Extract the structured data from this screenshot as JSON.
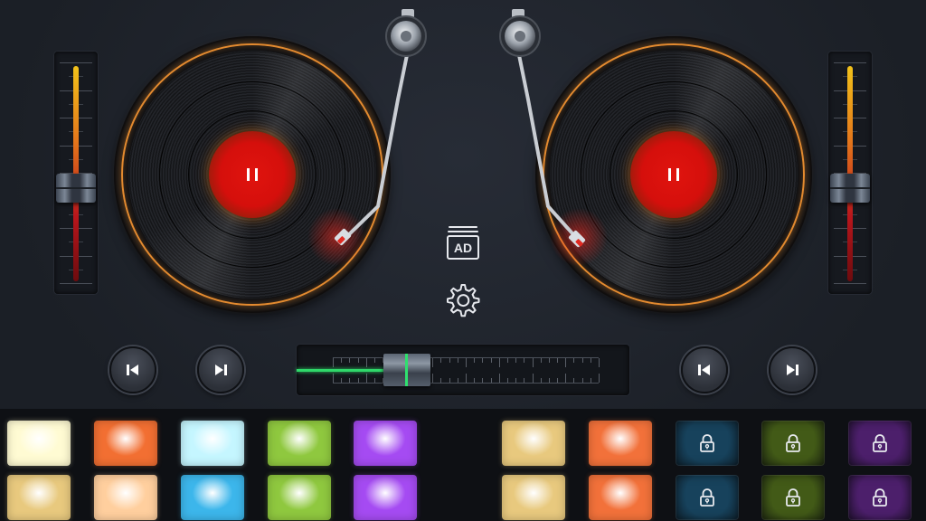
{
  "center": {
    "ad_label": "AD"
  },
  "icons": {
    "pause": "pause-icon",
    "skip_previous": "skip-previous-icon",
    "skip_next": "skip-next-icon",
    "settings": "gear-icon",
    "lock": "lock-icon",
    "ad": "ad-icon"
  },
  "decks": {
    "left": {
      "state": "playing",
      "pitch_position": 0.58
    },
    "right": {
      "state": "playing",
      "pitch_position": 0.58
    }
  },
  "crossfader": {
    "position": 0.28
  },
  "colors": {
    "accent_orange": "#e38a2f",
    "record_label": "#d50f0c",
    "crossfader_level": "#2fd86a"
  },
  "pads": {
    "left": [
      {
        "color": "#fffbd3",
        "locked": false
      },
      {
        "color": "#f26f32",
        "locked": false
      },
      {
        "color": "#c5f6ff",
        "locked": false
      },
      {
        "color": "#8fc83f",
        "locked": false
      },
      {
        "color": "#a54bf2",
        "locked": false
      },
      {
        "color": "#e8c97e",
        "locked": false
      },
      {
        "color": "#ffcf9e",
        "locked": false
      },
      {
        "color": "#3cb6eb",
        "locked": false
      },
      {
        "color": "#8fc83f",
        "locked": false
      },
      {
        "color": "#a54bf2",
        "locked": false
      }
    ],
    "right": [
      {
        "color": "#e8c97e",
        "locked": false
      },
      {
        "color": "#f2713a",
        "locked": false
      },
      {
        "color": "#17425c",
        "locked": true
      },
      {
        "color": "#425a17",
        "locked": true
      },
      {
        "color": "#4c1f6b",
        "locked": true
      },
      {
        "color": "#e8c97e",
        "locked": false
      },
      {
        "color": "#f2713a",
        "locked": false
      },
      {
        "color": "#17425c",
        "locked": true
      },
      {
        "color": "#425a17",
        "locked": true
      },
      {
        "color": "#4c1f6b",
        "locked": true
      }
    ]
  }
}
